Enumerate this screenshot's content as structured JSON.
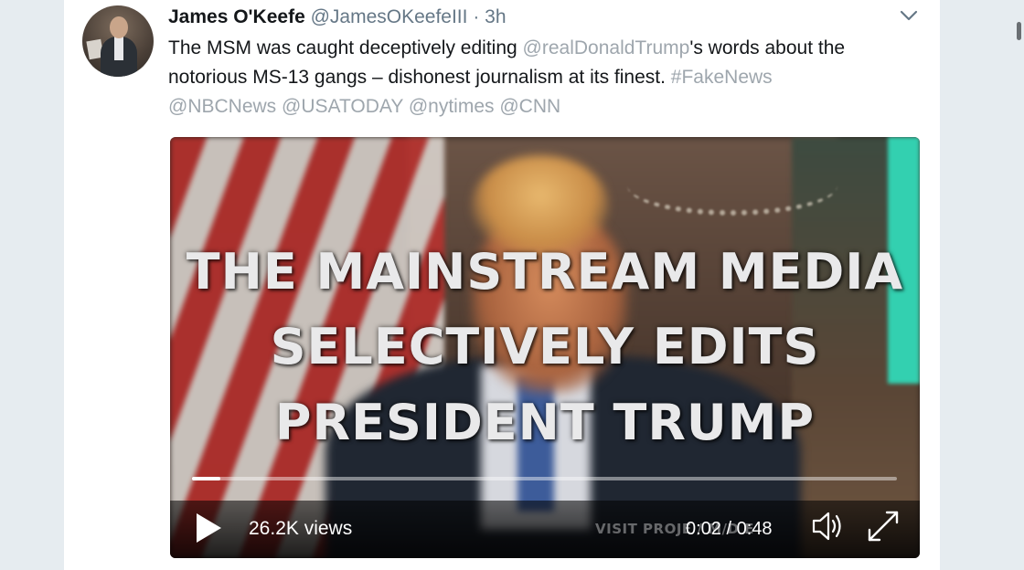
{
  "tweet": {
    "author_name": "James O'Keefe",
    "handle": "@JamesOKeefeIII",
    "separator": "·",
    "time": "3h",
    "text_part1": "The MSM was caught deceptively editing ",
    "mention_trump": "@realDonaldTrump",
    "text_part2": "'s words about the notorious MS-13 gangs – dishonest journalism at its finest. ",
    "hashtag": "#FakeNews",
    "mentions": [
      "@NBCNews",
      "@USATODAY",
      "@nytimes",
      "@CNN"
    ]
  },
  "video": {
    "overlay_lines": [
      "THE MAINSTREAM MEDIA",
      "SELECTIVELY EDITS",
      "PRESIDENT TRUMP"
    ],
    "views": "26.2K views",
    "watermark": "VISIT PROJE      /  M/D   E",
    "time_display": "0:02 / 0:48",
    "progress": 0.04
  },
  "icons": {
    "avatar": "profile-photo",
    "menu": "chevron-down-icon",
    "play": "play-icon",
    "volume": "speaker-icon",
    "fullscreen": "expand-icon"
  },
  "colors": {
    "link": "#9ea6ad",
    "text": "#14171a",
    "meta": "#657786",
    "page_bg": "#e6ecf0"
  }
}
